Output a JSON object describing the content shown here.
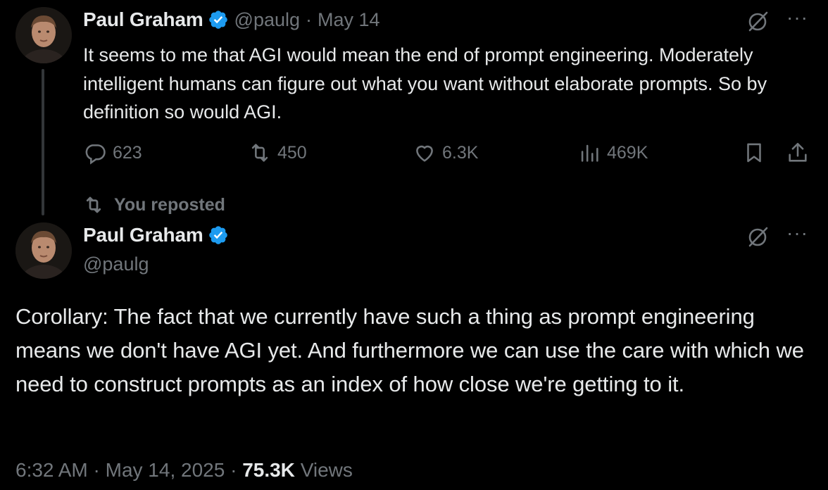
{
  "tweet1": {
    "author_name": "Paul Graham",
    "handle": "@paulg",
    "separator": "·",
    "date": "May 14",
    "text": "It seems to me that AGI would mean the end of prompt engineering. Moderately intelligent humans can figure out what you want without elaborate prompts. So by definition so would AGI.",
    "replies": "623",
    "reposts": "450",
    "likes": "6.3K",
    "views": "469K",
    "more": "···"
  },
  "repost_context": {
    "label": "You reposted"
  },
  "tweet2": {
    "author_name": "Paul Graham",
    "handle": "@paulg",
    "text": "Corollary: The fact that we currently have such a thing as prompt engineering means we don't have AGI yet. And furthermore we can use the care with which we need to construct prompts as an index of how close we're getting to it.",
    "time": "6:32 AM",
    "sep1": "·",
    "full_date": "May 14, 2025",
    "sep2": "·",
    "views_count": "75.3K",
    "views_label": "Views",
    "more": "···"
  },
  "colors": {
    "background": "#000000",
    "text": "#e7e9ea",
    "muted": "#71767b",
    "verified": "#1d9bf0",
    "thread_line": "#333639"
  },
  "icons": {
    "verified": "verified-badge-icon",
    "grok": "grok-icon",
    "more": "more-icon",
    "reply": "reply-icon",
    "repost": "repost-icon",
    "like": "heart-icon",
    "views": "views-bar-chart-icon",
    "bookmark": "bookmark-icon",
    "share": "share-icon"
  }
}
